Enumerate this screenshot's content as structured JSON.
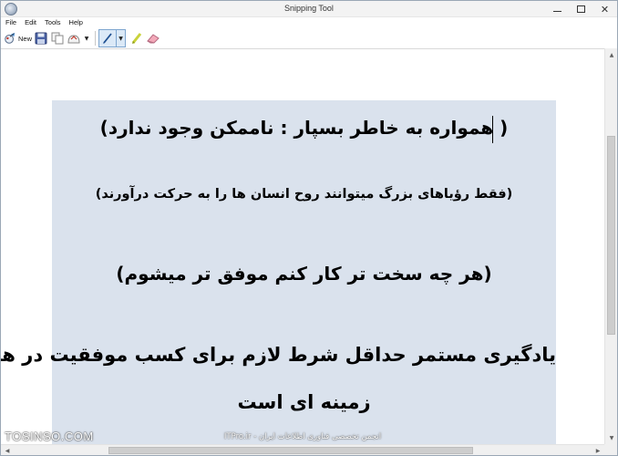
{
  "window": {
    "title": "Snipping Tool",
    "close_label": "✕"
  },
  "menu": {
    "items": [
      {
        "label": "File"
      },
      {
        "label": "Edit"
      },
      {
        "label": "Tools"
      },
      {
        "label": "Help"
      }
    ]
  },
  "toolbar": {
    "new_label": "New",
    "icons": [
      "new-snip-icon",
      "save-icon",
      "copy-icon",
      "send-snip-icon",
      "pen-icon",
      "highlighter-icon",
      "eraser-icon"
    ]
  },
  "content": {
    "lines": [
      "( همواره به خاطر بسپار : ناممکن وجود ندارد)",
      "(فقط رؤیاهای بزرگ میتوانند روح انسان ها را به حرکت درآورند)",
      "(هر چه سخت تر کار کنم موفق تر میشوم)",
      "یادگیری مستمر حداقل شرط لازم برای کسب موفقیت در هر",
      "زمینه ای است"
    ]
  },
  "watermark": {
    "left": "TOSINSO.COM",
    "center": "ITPro.ir - انجمن تخصصی فناوری اطلاعات ایران"
  },
  "colors": {
    "slide_background": "#dae2ed",
    "pen_active": "#dbe9f7"
  }
}
